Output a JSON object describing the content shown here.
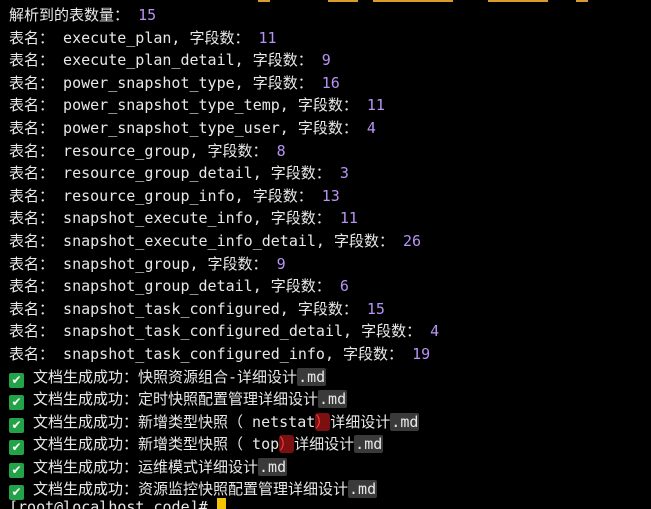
{
  "terminal": {
    "summary": {
      "label": "解析到的表数量",
      "colon": "：",
      "value": "15"
    },
    "table_prefix": "表名：",
    "field_label": "字段数：",
    "tables": [
      {
        "name": "execute_plan",
        "fields": "11"
      },
      {
        "name": "execute_plan_detail",
        "fields": "9"
      },
      {
        "name": "power_snapshot_type",
        "fields": "16"
      },
      {
        "name": "power_snapshot_type_temp",
        "fields": "11"
      },
      {
        "name": "power_snapshot_type_user",
        "fields": "4"
      },
      {
        "name": "resource_group",
        "fields": "8"
      },
      {
        "name": "resource_group_detail",
        "fields": "3"
      },
      {
        "name": "resource_group_info",
        "fields": "13"
      },
      {
        "name": "snapshot_execute_info",
        "fields": "11"
      },
      {
        "name": "snapshot_execute_info_detail",
        "fields": "26"
      },
      {
        "name": "snapshot_group",
        "fields": "9"
      },
      {
        "name": "snapshot_group_detail",
        "fields": "6"
      },
      {
        "name": "snapshot_task_configured",
        "fields": "15"
      },
      {
        "name": "snapshot_task_configured_detail",
        "fields": "4"
      },
      {
        "name": "snapshot_task_configured_info",
        "fields": "19"
      }
    ],
    "success_prefix": "文档生成成功：",
    "docs": [
      {
        "name": "快照资源组合-详细设计",
        "ext": ".md"
      },
      {
        "name": "定时快照配置管理详细设计",
        "ext": ".md"
      },
      {
        "name_a": "新增类型快照（ netstat",
        "paren": "）",
        "name_b": "详细设计",
        "ext": ".md"
      },
      {
        "name_a": "新增类型快照（ top",
        "paren": "）",
        "name_b": "详细设计",
        "ext": ".md"
      },
      {
        "name": "运维模式详细设计",
        "ext": ".md"
      },
      {
        "name": "资源监控快照配置管理详细设计",
        "ext": ".md"
      }
    ],
    "prompt": "[root@localhost code]# ",
    "colors": {
      "background": "#000000",
      "text": "#e8e8e8",
      "number": "#b794f4",
      "check": "#22a348",
      "cursor": "#f5c400"
    }
  }
}
